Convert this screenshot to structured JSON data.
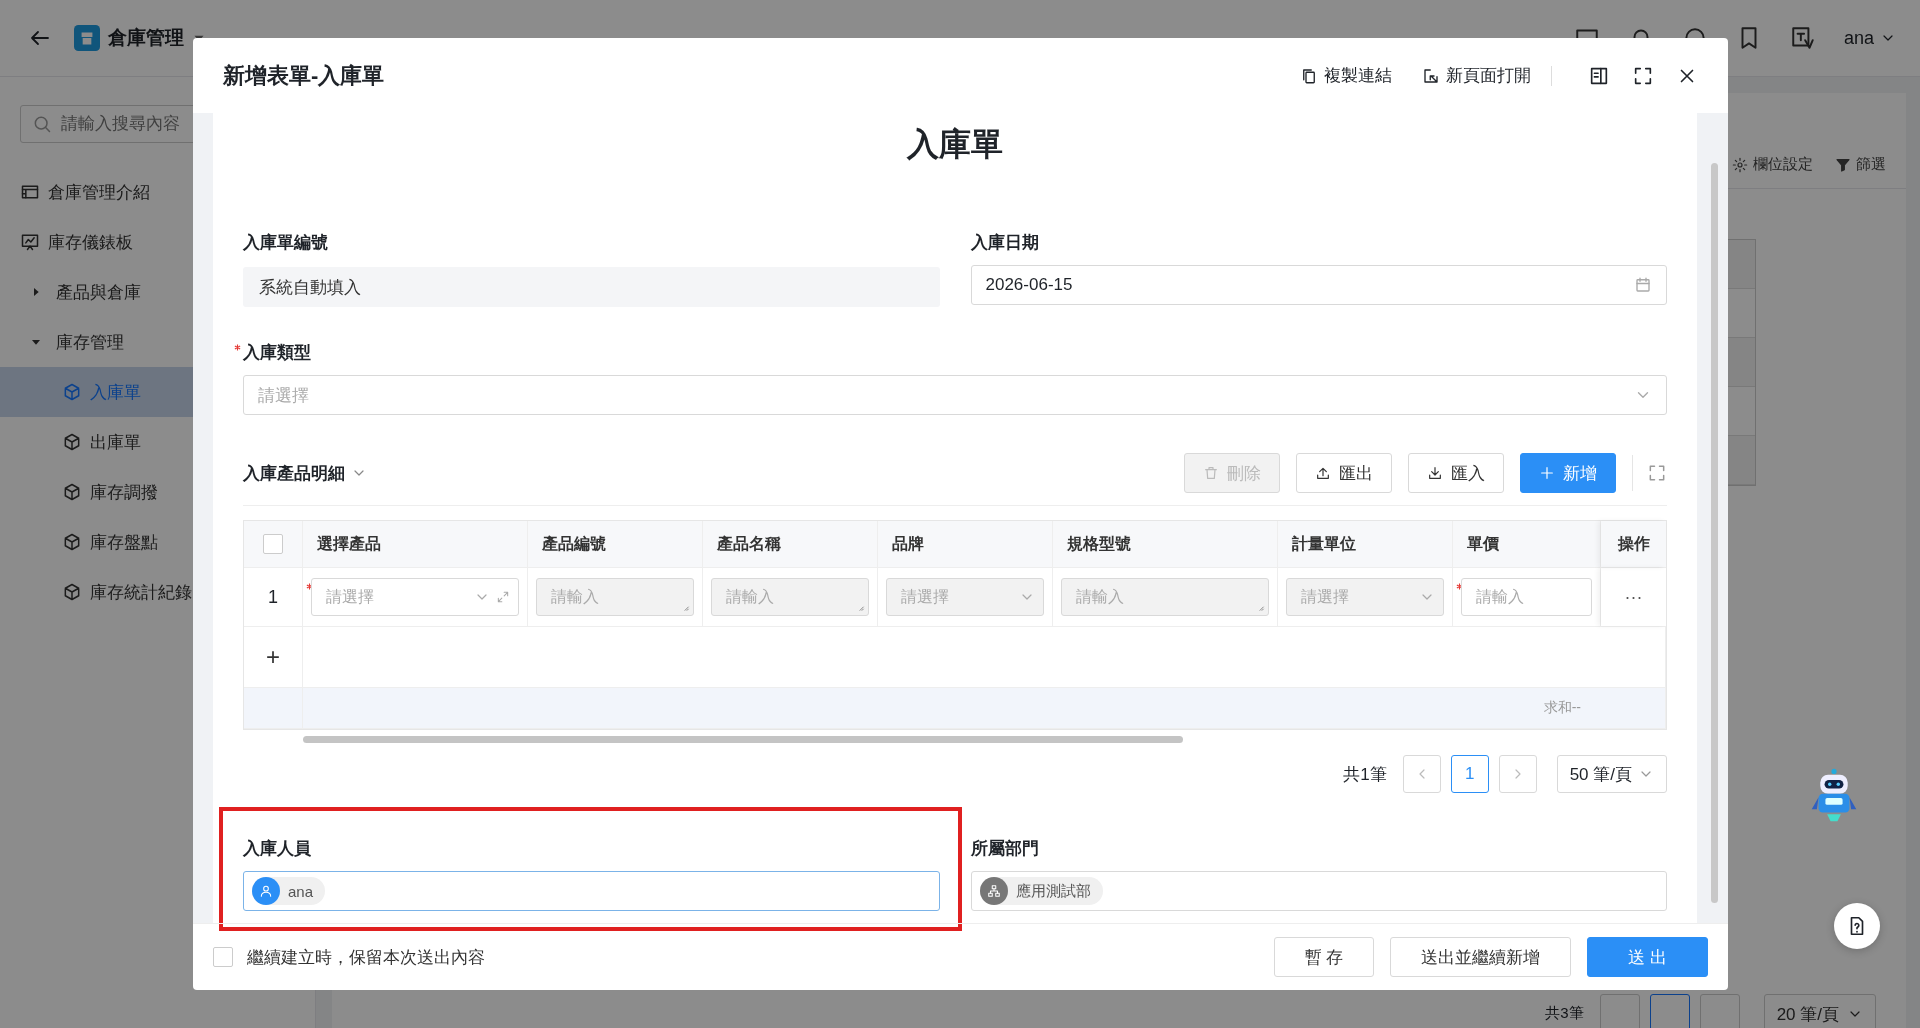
{
  "topbar": {
    "app_title": "倉庫管理",
    "user": "ana"
  },
  "sidebar": {
    "search_placeholder": "請輸入搜尋內容",
    "items": [
      {
        "label": "倉庫管理介紹",
        "kind": "page",
        "selected": false
      },
      {
        "label": "庫存儀錶板",
        "kind": "dashboard",
        "selected": false
      },
      {
        "label": "產品與倉庫",
        "kind": "group",
        "expanded": false
      },
      {
        "label": "庫存管理",
        "kind": "group",
        "expanded": true,
        "children": [
          {
            "label": "入庫單",
            "kind": "form",
            "selected": true
          },
          {
            "label": "出庫單",
            "kind": "form",
            "selected": false
          },
          {
            "label": "庫存調撥",
            "kind": "form",
            "selected": false
          },
          {
            "label": "庫存盤點",
            "kind": "form",
            "selected": false
          },
          {
            "label": "庫存統計紀錄",
            "kind": "form",
            "selected": false
          }
        ]
      }
    ]
  },
  "background": {
    "toolbar": [
      {
        "label": "欄位設定",
        "kind": "columns"
      },
      {
        "label": "篩選",
        "kind": "filter"
      }
    ],
    "pagination": {
      "total": "共3筆",
      "page_size": "20 筆/頁"
    }
  },
  "modal": {
    "title": "新增表單-入庫單",
    "actions": [
      {
        "label": "複製連結",
        "kind": "copy"
      },
      {
        "label": "新頁面打開",
        "kind": "open"
      }
    ],
    "form": {
      "heading": "入庫單",
      "order_no": {
        "label": "入庫單編號",
        "value": "系統自動填入"
      },
      "date": {
        "label": "入庫日期",
        "value": "2026-06-15"
      },
      "type": {
        "label": "入庫類型",
        "required": true,
        "placeholder": "請選擇"
      },
      "details": {
        "title": "入庫產品明細",
        "buttons": [
          {
            "label": "刪除",
            "kind": "delete",
            "disabled": true
          },
          {
            "label": "匯出",
            "kind": "export",
            "disabled": false
          },
          {
            "label": "匯入",
            "kind": "import",
            "disabled": false
          },
          {
            "label": "新增",
            "kind": "add",
            "disabled": false
          }
        ],
        "columns": [
          "選擇產品",
          "產品編號",
          "產品名稱",
          "品牌",
          "規格型號",
          "計量單位",
          "單價",
          "操作"
        ],
        "select_all": {
          "checked": false
        },
        "rows": [
          {
            "index": "1",
            "cells": [
              {
                "kind": "picker",
                "placeholder": "請選擇",
                "required": true,
                "disabled": false
              },
              {
                "kind": "textarea",
                "placeholder": "請輸入",
                "required": false,
                "disabled": true
              },
              {
                "kind": "textarea",
                "placeholder": "請輸入",
                "required": false,
                "disabled": true
              },
              {
                "kind": "select",
                "placeholder": "請選擇",
                "required": false,
                "disabled": true
              },
              {
                "kind": "textarea",
                "placeholder": "請輸入",
                "required": false,
                "disabled": true
              },
              {
                "kind": "select",
                "placeholder": "請選擇",
                "required": false,
                "disabled": true
              },
              {
                "kind": "input",
                "placeholder": "請輸入",
                "required": true,
                "disabled": false
              }
            ],
            "action": "···"
          }
        ],
        "add_row": "+",
        "summary": "求和--",
        "pagination": {
          "total": "共1筆",
          "pages": [
            {
              "label": "1",
              "selected": true
            }
          ],
          "page_size": "50 筆/頁"
        }
      },
      "submitter": {
        "label": "入庫人員",
        "highlighted": true,
        "tags": [
          {
            "label": "ana",
            "kind": "user"
          }
        ]
      },
      "department": {
        "label": "所屬部門",
        "highlighted": false,
        "tags": [
          {
            "label": "應用測試部",
            "kind": "department"
          }
        ]
      }
    },
    "footer": {
      "keep": {
        "label": "繼續建立時，保留本次送出內容",
        "checked": false
      },
      "buttons": [
        {
          "label": "暫 存",
          "kind": "default"
        },
        {
          "label": "送出並繼續新增",
          "kind": "default"
        },
        {
          "label": "送 出",
          "kind": "primary"
        }
      ]
    }
  }
}
